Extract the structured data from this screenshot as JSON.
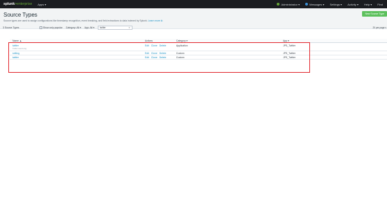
{
  "topbar": {
    "brand_main": "splunk",
    "brand_sub": ">enterprise",
    "apps_label": "Apps ▾",
    "admin_label": "Administrator ▾",
    "messages_label": "Messages ▾",
    "settings_label": "Settings ▾",
    "activity_label": "Activity ▾",
    "help_label": "Help ▾",
    "find_label": "Find",
    "messages_count": "1"
  },
  "header": {
    "title": "Source Types",
    "description": "Source types are used to assign configurations like timestamp recognition, event breaking, and field extractions to data indexed by Splunk.",
    "learn_more": "Learn more ⧉",
    "new_button": "New Source Type"
  },
  "filters": {
    "count_label": "3 Source Types",
    "popular_label": "Show only popular",
    "category_label": "Category: All ▾",
    "app_label": "App: All ▾",
    "search_value": "twitter",
    "per_page": "20 per page ▾"
  },
  "table": {
    "headers": {
      "name": "Name ▲",
      "actions": "Actions",
      "category": "Category ▾",
      "app": "App ▾"
    },
    "rows": [
      {
        "name": "twitter",
        "sub": "Twitter events log",
        "edit": "Edit",
        "clone": "Clone",
        "delete": "Delete",
        "category": "Application",
        "app": "JPS_Twitter"
      },
      {
        "name": "setting",
        "sub": "",
        "edit": "Edit",
        "clone": "Clone",
        "delete": "Delete",
        "category": "Custom",
        "app": "JPS_Twitter"
      },
      {
        "name": "twitter",
        "sub": "",
        "edit": "Edit",
        "clone": "Clone",
        "delete": "Delete",
        "category": "Custom",
        "app": "JPS_Twitter"
      }
    ]
  },
  "colors": {
    "accent": "#1e93c6",
    "highlight": "#e1262c",
    "button_green": "#5cc05c"
  }
}
